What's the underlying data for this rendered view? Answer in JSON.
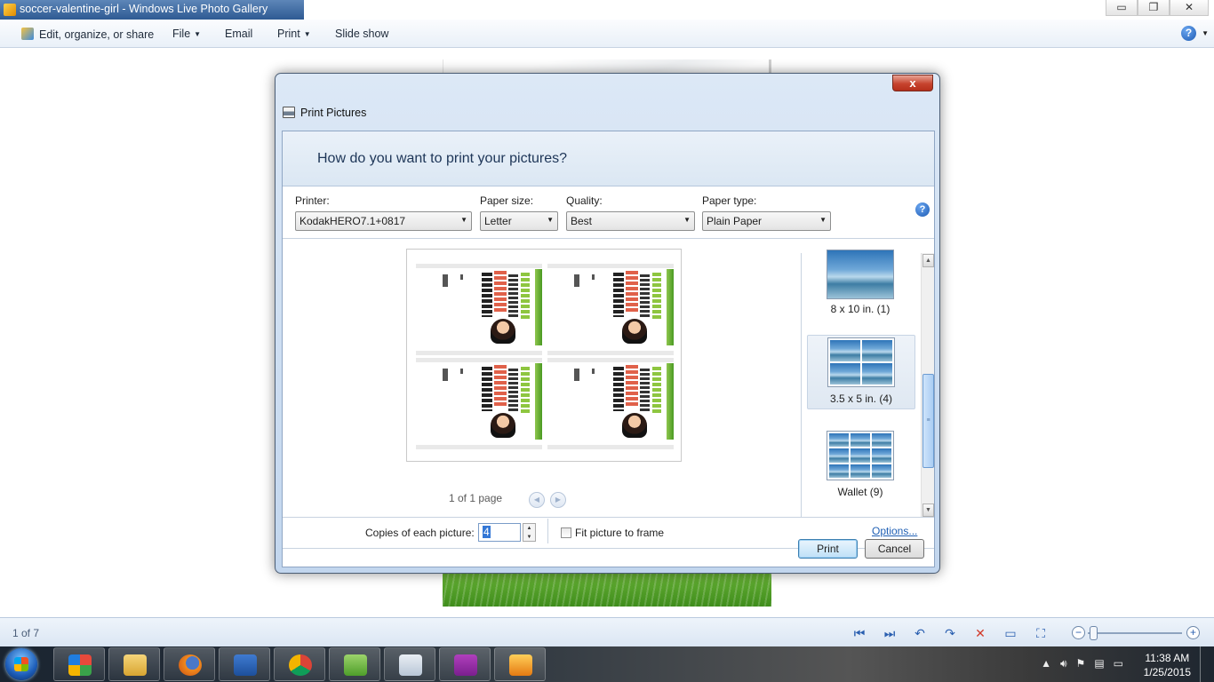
{
  "window": {
    "title": "soccer-valentine-girl - Windows Live Photo Gallery",
    "minimize": "▭",
    "restore": "❐",
    "close": "✕"
  },
  "menubar": {
    "items": [
      {
        "label": "Edit, organize, or share",
        "has_menu": false
      },
      {
        "label": "File",
        "has_menu": true
      },
      {
        "label": "Email",
        "has_menu": false
      },
      {
        "label": "Print",
        "has_menu": true
      },
      {
        "label": "Slide show",
        "has_menu": false
      }
    ],
    "help": "?"
  },
  "dialog": {
    "title": "Print Pictures",
    "close": "x",
    "question": "How do you want to print your pictures?",
    "help": "?",
    "fields": [
      {
        "label": "Printer:",
        "value": "KodakHERO7.1+0817"
      },
      {
        "label": "Paper size:",
        "value": "Letter"
      },
      {
        "label": "Quality:",
        "value": "Best"
      },
      {
        "label": "Paper type:",
        "value": "Plain Paper"
      }
    ],
    "page_info": "1 of 1 page",
    "layouts": [
      {
        "label": "8 x 10 in. (1)",
        "selected": false
      },
      {
        "label": "3.5 x 5 in. (4)",
        "selected": true
      },
      {
        "label": "Wallet (9)",
        "selected": false
      }
    ],
    "copies_label": "Copies of each picture:",
    "copies_value": "4",
    "fit_label": "Fit picture to frame",
    "fit_checked": false,
    "options_link": "Options...",
    "print_button": "Print",
    "cancel_button": "Cancel"
  },
  "statusbar": {
    "position": "1 of 7"
  },
  "taskbar": {
    "time": "11:38 AM",
    "date": "1/25/2015",
    "apps": [
      "start-menu-tiles",
      "file-explorer",
      "firefox",
      "word",
      "chrome",
      "evernote",
      "publisher",
      "facebook",
      "photo-gallery"
    ]
  },
  "colors": {
    "accent": "#2e5a93",
    "dialog_close": "#c7432e",
    "link": "#1f5fb4"
  }
}
